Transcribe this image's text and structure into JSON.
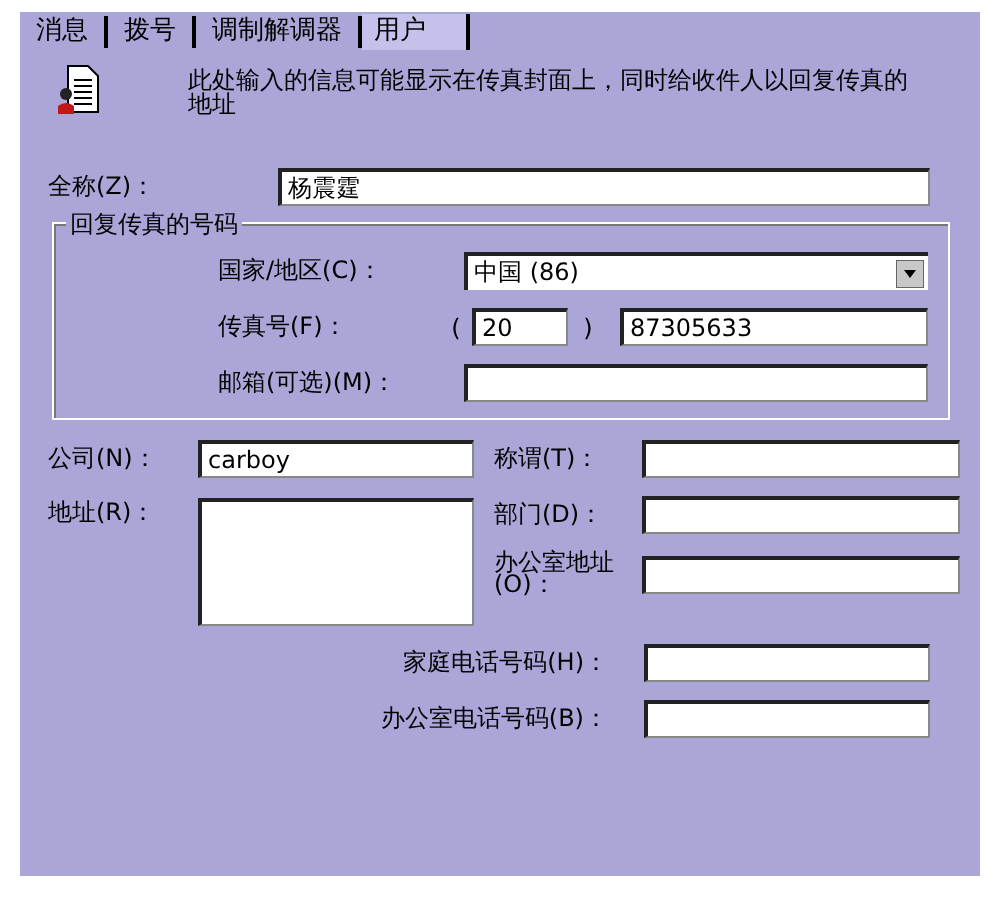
{
  "tabs": [
    {
      "label": "消息",
      "selected": false
    },
    {
      "label": "拨号",
      "selected": false
    },
    {
      "label": "调制解调器",
      "selected": false
    },
    {
      "label": "用户",
      "selected": true
    }
  ],
  "intro": "此处输入的信息可能显示在传真封面上，同时给收件人以回复传真的地址",
  "full_name": {
    "label": "全称(Z)：",
    "value": "杨震霆"
  },
  "reply_fax": {
    "title": "回复传真的号码",
    "country": {
      "label": "国家/地区(C)：",
      "value": "中国 (86)"
    },
    "fax": {
      "label": "传真号(F)：",
      "open_paren": "(",
      "area_code": "20",
      "close_paren": ")",
      "number": "87305633"
    },
    "mailbox": {
      "label": "邮箱(可选)(M)："
    }
  },
  "company": {
    "label": "公司(N)：",
    "value": "carboy"
  },
  "address": {
    "label": "地址(R)："
  },
  "title_field": {
    "label": "称谓(T)："
  },
  "department": {
    "label": "部门(D)："
  },
  "office_location": {
    "label": "办公室地址(O)："
  },
  "home_phone": {
    "label": "家庭电话号码(H)："
  },
  "office_phone": {
    "label": "办公室电话号码(B)："
  }
}
